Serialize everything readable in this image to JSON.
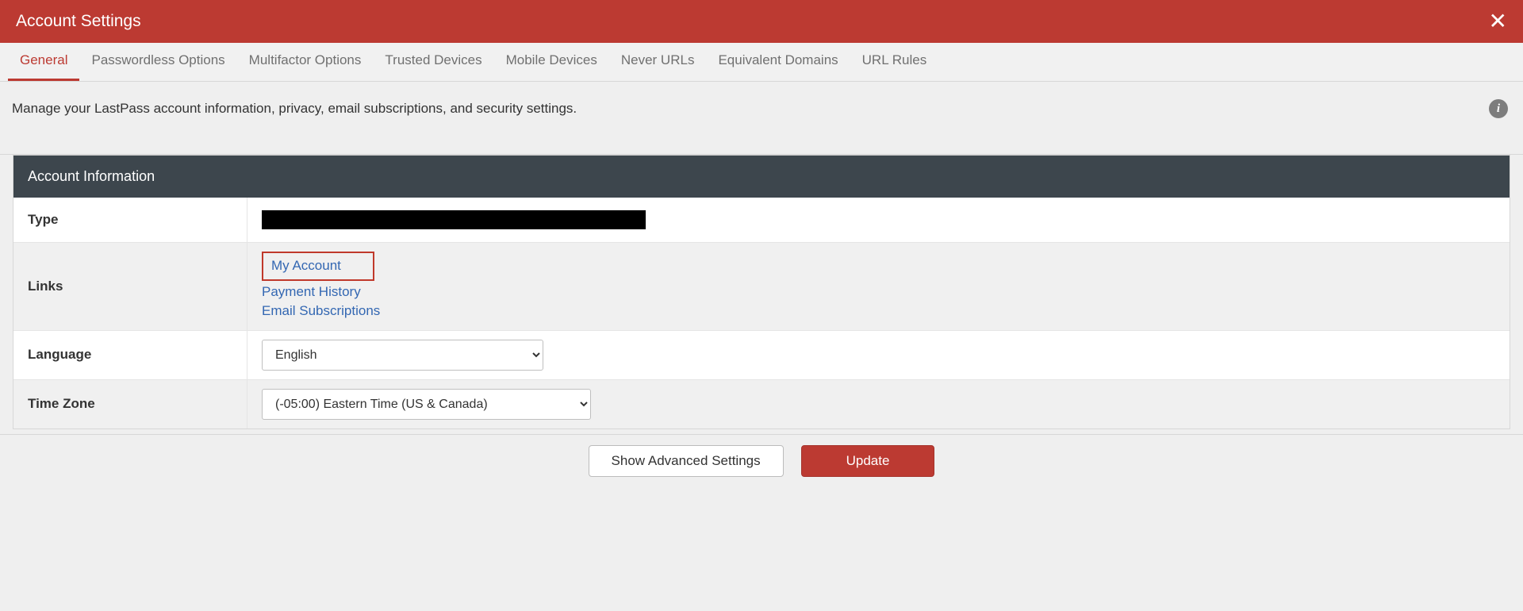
{
  "header": {
    "title": "Account Settings"
  },
  "tabs": {
    "general": "General",
    "passwordless": "Passwordless Options",
    "multifactor": "Multifactor Options",
    "trusted_devices": "Trusted Devices",
    "mobile_devices": "Mobile Devices",
    "never_urls": "Never URLs",
    "equivalent_domains": "Equivalent Domains",
    "url_rules": "URL Rules"
  },
  "description": "Manage your LastPass account information, privacy, email subscriptions, and security settings.",
  "panel": {
    "title": "Account Information",
    "rows": {
      "type": {
        "label": "Type"
      },
      "links": {
        "label": "Links",
        "my_account": "My Account",
        "payment_history": "Payment History",
        "email_subscriptions": "Email Subscriptions"
      },
      "language": {
        "label": "Language",
        "value": "English"
      },
      "timezone": {
        "label": "Time Zone",
        "value": "(-05:00) Eastern Time (US & Canada)"
      }
    }
  },
  "footer": {
    "show_advanced": "Show Advanced Settings",
    "update": "Update"
  }
}
